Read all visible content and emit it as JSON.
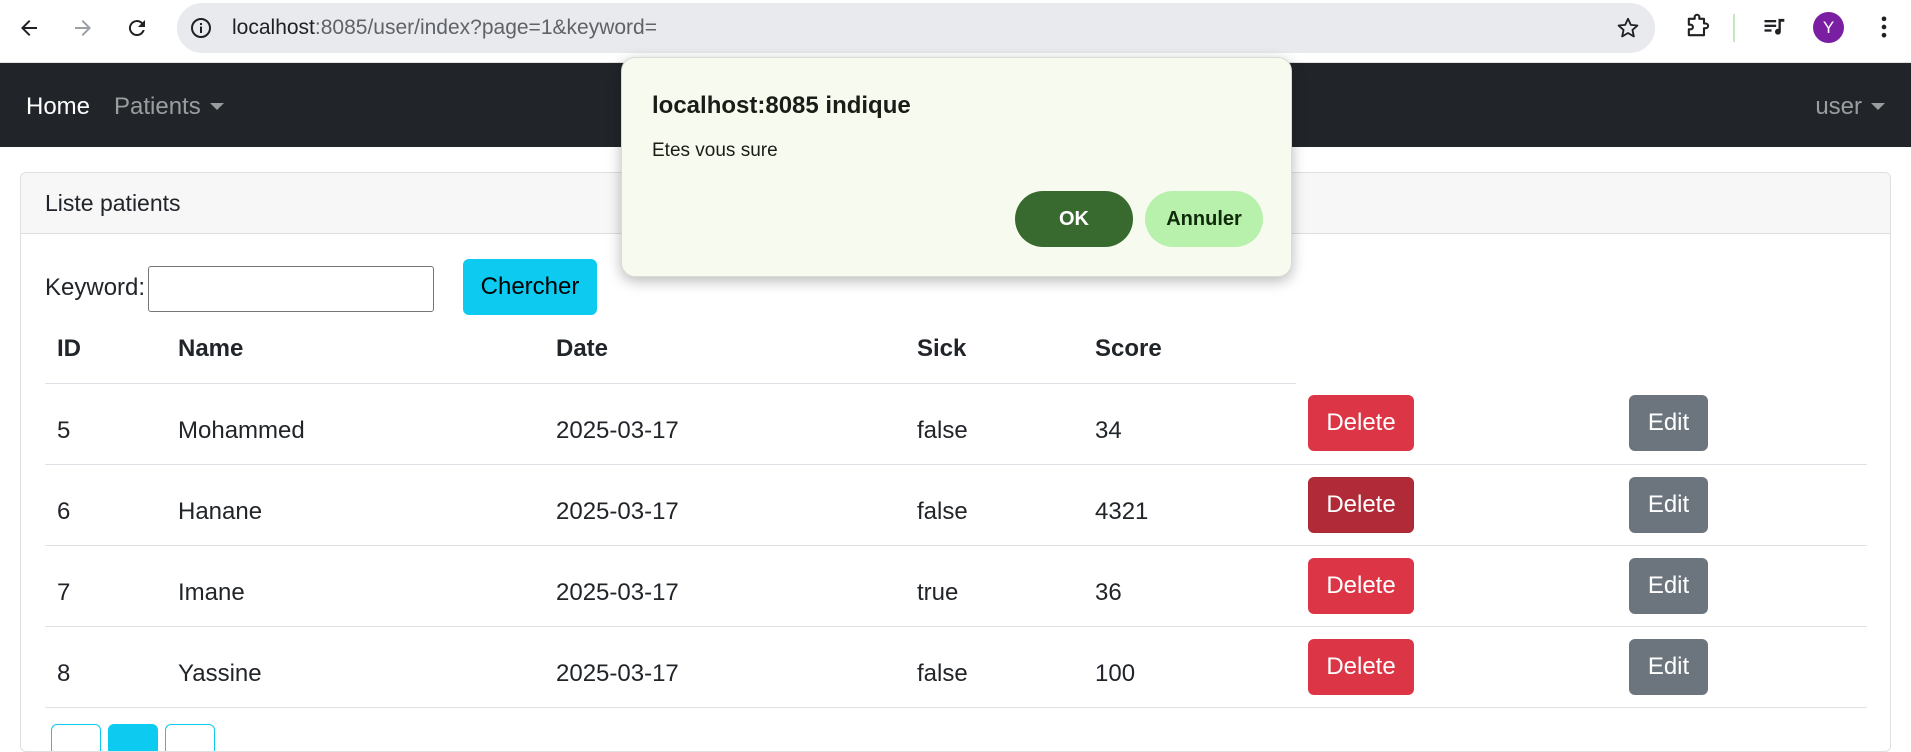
{
  "browser": {
    "url_host": "localhost",
    "url_rest": ":8085/user/index?page=1&keyword=",
    "profile_initial": "Y",
    "icons": [
      "back-arrow-icon",
      "forward-arrow-icon",
      "reload-icon",
      "info-icon",
      "star-icon",
      "extensions-icon",
      "media-icon",
      "kebab-menu-icon"
    ]
  },
  "navbar": {
    "home": "Home",
    "patients": "Patients",
    "user": "user"
  },
  "card": {
    "header": "Liste patients",
    "keyword_label": "Keyword:",
    "keyword_value": "",
    "search_button": "Chercher"
  },
  "table": {
    "columns": [
      "ID",
      "Name",
      "Date",
      "Sick",
      "Score"
    ],
    "rows": [
      {
        "id": "5",
        "name": "Mohammed",
        "date": "2025-03-17",
        "sick": "false",
        "score": "34",
        "delete": "Delete",
        "edit": "Edit"
      },
      {
        "id": "6",
        "name": "Hanane",
        "date": "2025-03-17",
        "sick": "false",
        "score": "4321",
        "delete": "Delete",
        "edit": "Edit"
      },
      {
        "id": "7",
        "name": "Imane",
        "date": "2025-03-17",
        "sick": "true",
        "score": "36",
        "delete": "Delete",
        "edit": "Edit"
      },
      {
        "id": "8",
        "name": "Yassine",
        "date": "2025-03-17",
        "sick": "false",
        "score": "100",
        "delete": "Delete",
        "edit": "Edit"
      }
    ]
  },
  "pagination": {
    "active_page_index": 1,
    "page_count_visible": 3
  },
  "dialog": {
    "title": "localhost:8085 indique",
    "message": "Etes vous sure",
    "ok": "OK",
    "cancel": "Annuler"
  },
  "colors": {
    "navbar_bg": "#212529",
    "info": "#0dcaf0",
    "danger": "#dc3545",
    "danger_hover": "#b02a37",
    "secondary": "#6c757d",
    "dialog_bg": "#f7fbef",
    "dialog_ok": "#386a30",
    "dialog_cancel": "#b8f1ab",
    "profile": "#7b1fa2"
  }
}
